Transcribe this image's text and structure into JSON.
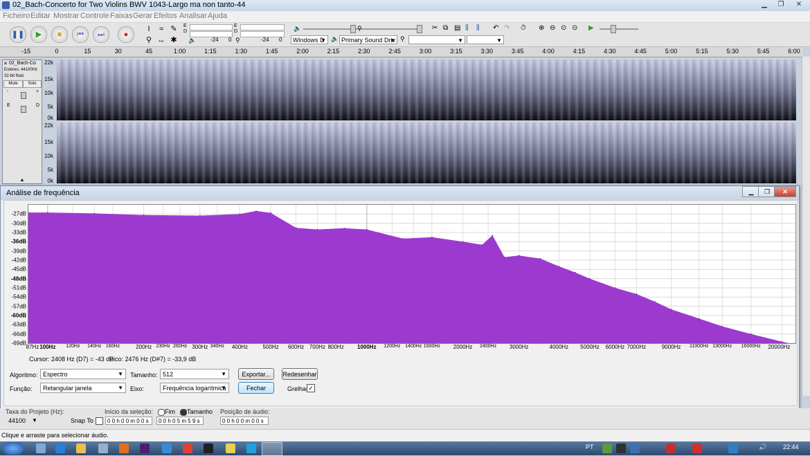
{
  "window": {
    "title": "02_Bach-Concerto for Two Violins BWV 1043-Largo ma non tanto-44"
  },
  "menu": [
    "Ficheiro",
    "Editar",
    "Mostrar",
    "Controle",
    "Faixas",
    "Gerar",
    "Efeitos",
    "Analisar",
    "Ajuda"
  ],
  "meters": {
    "rec_db": "-24",
    "rec_zero": "0",
    "play_db": "-24",
    "play_zero": "0",
    "rec_label": "E\nD",
    "play_label": "E\nD"
  },
  "devices": {
    "host": "Windows D",
    "output": "Primary Sound Driv",
    "input": ""
  },
  "timeline": {
    "ticks": [
      "-15",
      "0",
      "15",
      "30",
      "45",
      "1:00",
      "1:15",
      "1:30",
      "1:45",
      "2:00",
      "2:15",
      "2:30",
      "2:45",
      "3:00",
      "3:15",
      "3:30",
      "3:45",
      "4:00",
      "4:15",
      "4:30",
      "4:45",
      "5:00",
      "5:15",
      "5:30",
      "5:45",
      "6:00"
    ]
  },
  "track": {
    "name": "02_Bach-Co",
    "info1": "Estéreo, 44100Hz",
    "info2": "32-bit float",
    "mute": "Mute",
    "solo": "Solo",
    "gain_minus": "-",
    "gain_plus": "+",
    "pan_left": "E",
    "pan_right": "D",
    "scale": [
      "22k",
      "15k",
      "10k",
      "5k",
      "0k"
    ]
  },
  "dialog": {
    "title": "Análise de frequência",
    "cursor": "Cursor: 2408 Hz (D7) = -43 dB",
    "peak": "Pico: 2476 Hz (D#7) = -33,9 dB",
    "algorithm_label": "Algoritmo:",
    "algorithm_value": "Espectro",
    "size_label": "Tamanho:",
    "size_value": "512",
    "export_button": "Exportar...",
    "replot_button": "Redesenhar",
    "function_label": "Função:",
    "function_value": "Retangular janela",
    "axis_label": "Eixo:",
    "axis_value": "Frequência logarítmica",
    "close_button": "Fechar",
    "grids_label": "Grelhas",
    "grids_checked": true
  },
  "chart_data": {
    "type": "area",
    "title": "",
    "xlabel": "",
    "ylabel": "",
    "xscale": "log",
    "xlim": [
      87,
      22050
    ],
    "ylim": [
      -69,
      -24
    ],
    "grid": true,
    "y_ticks": [
      "-27dB",
      "-30dB",
      "-33dB",
      "-36dB",
      "-39dB",
      "-42dB",
      "-45dB",
      "-48dB",
      "-51dB",
      "-54dB",
      "-57dB",
      "-60dB",
      "-63dB",
      "-66dB",
      "-69dB"
    ],
    "x_ticks": [
      "87Hz",
      "100Hz",
      "120Hz",
      "140Hz",
      "160Hz",
      "200Hz",
      "230Hz",
      "260Hz",
      "300Hz",
      "340Hz",
      "400Hz",
      "500Hz",
      "600Hz",
      "700Hz",
      "800Hz",
      "1000Hz",
      "1200Hz",
      "1400Hz",
      "1600Hz",
      "2000Hz",
      "2400Hz",
      "3000Hz",
      "4000Hz",
      "5000Hz",
      "6000Hz",
      "7000Hz",
      "9000Hz",
      "11000Hz",
      "13000Hz",
      "16000Hz",
      "20000Hz"
    ],
    "x": [
      87,
      100,
      140,
      200,
      300,
      400,
      450,
      500,
      600,
      700,
      850,
      1000,
      1300,
      1600,
      2000,
      2300,
      2476,
      2700,
      3000,
      3500,
      4000,
      4500,
      5000,
      6000,
      7000,
      8000,
      9000,
      11000,
      13000,
      16000,
      20000,
      22050
    ],
    "values": [
      -26.5,
      -26.5,
      -26.8,
      -27.3,
      -27.5,
      -27.0,
      -26.0,
      -26.6,
      -31.5,
      -32.0,
      -31.6,
      -32.0,
      -35.0,
      -34.5,
      -36.0,
      -37.0,
      -33.9,
      -41.0,
      -40.5,
      -41.5,
      -44.0,
      -46.0,
      -48.0,
      -51.0,
      -53.0,
      -55.5,
      -58.0,
      -61.0,
      -63.5,
      -66.0,
      -68.5,
      -69.5
    ]
  },
  "selection_bar": {
    "rate_label": "Taxa do Projeto (Hz):",
    "rate_value": "44100",
    "snap_label": "Snap To",
    "sel_label": "Início da seleção:",
    "end_label": "Fim",
    "len_label": "Tamanho",
    "start_value": "0 0 h 0 0 m 0 0 s",
    "length_value": "0 0 h 0 5 m 5 9 s",
    "pos_label": "Posição de áudio:",
    "pos_value": "0 0 h 0 0 m 0 0 s"
  },
  "status": "Clique e arraste para selecionar áudio.",
  "taskbar": {
    "lang": "PT",
    "clock": "22:44"
  },
  "colors": {
    "spectrum": "#9c3ad0",
    "accent": "#3c7fb1"
  }
}
